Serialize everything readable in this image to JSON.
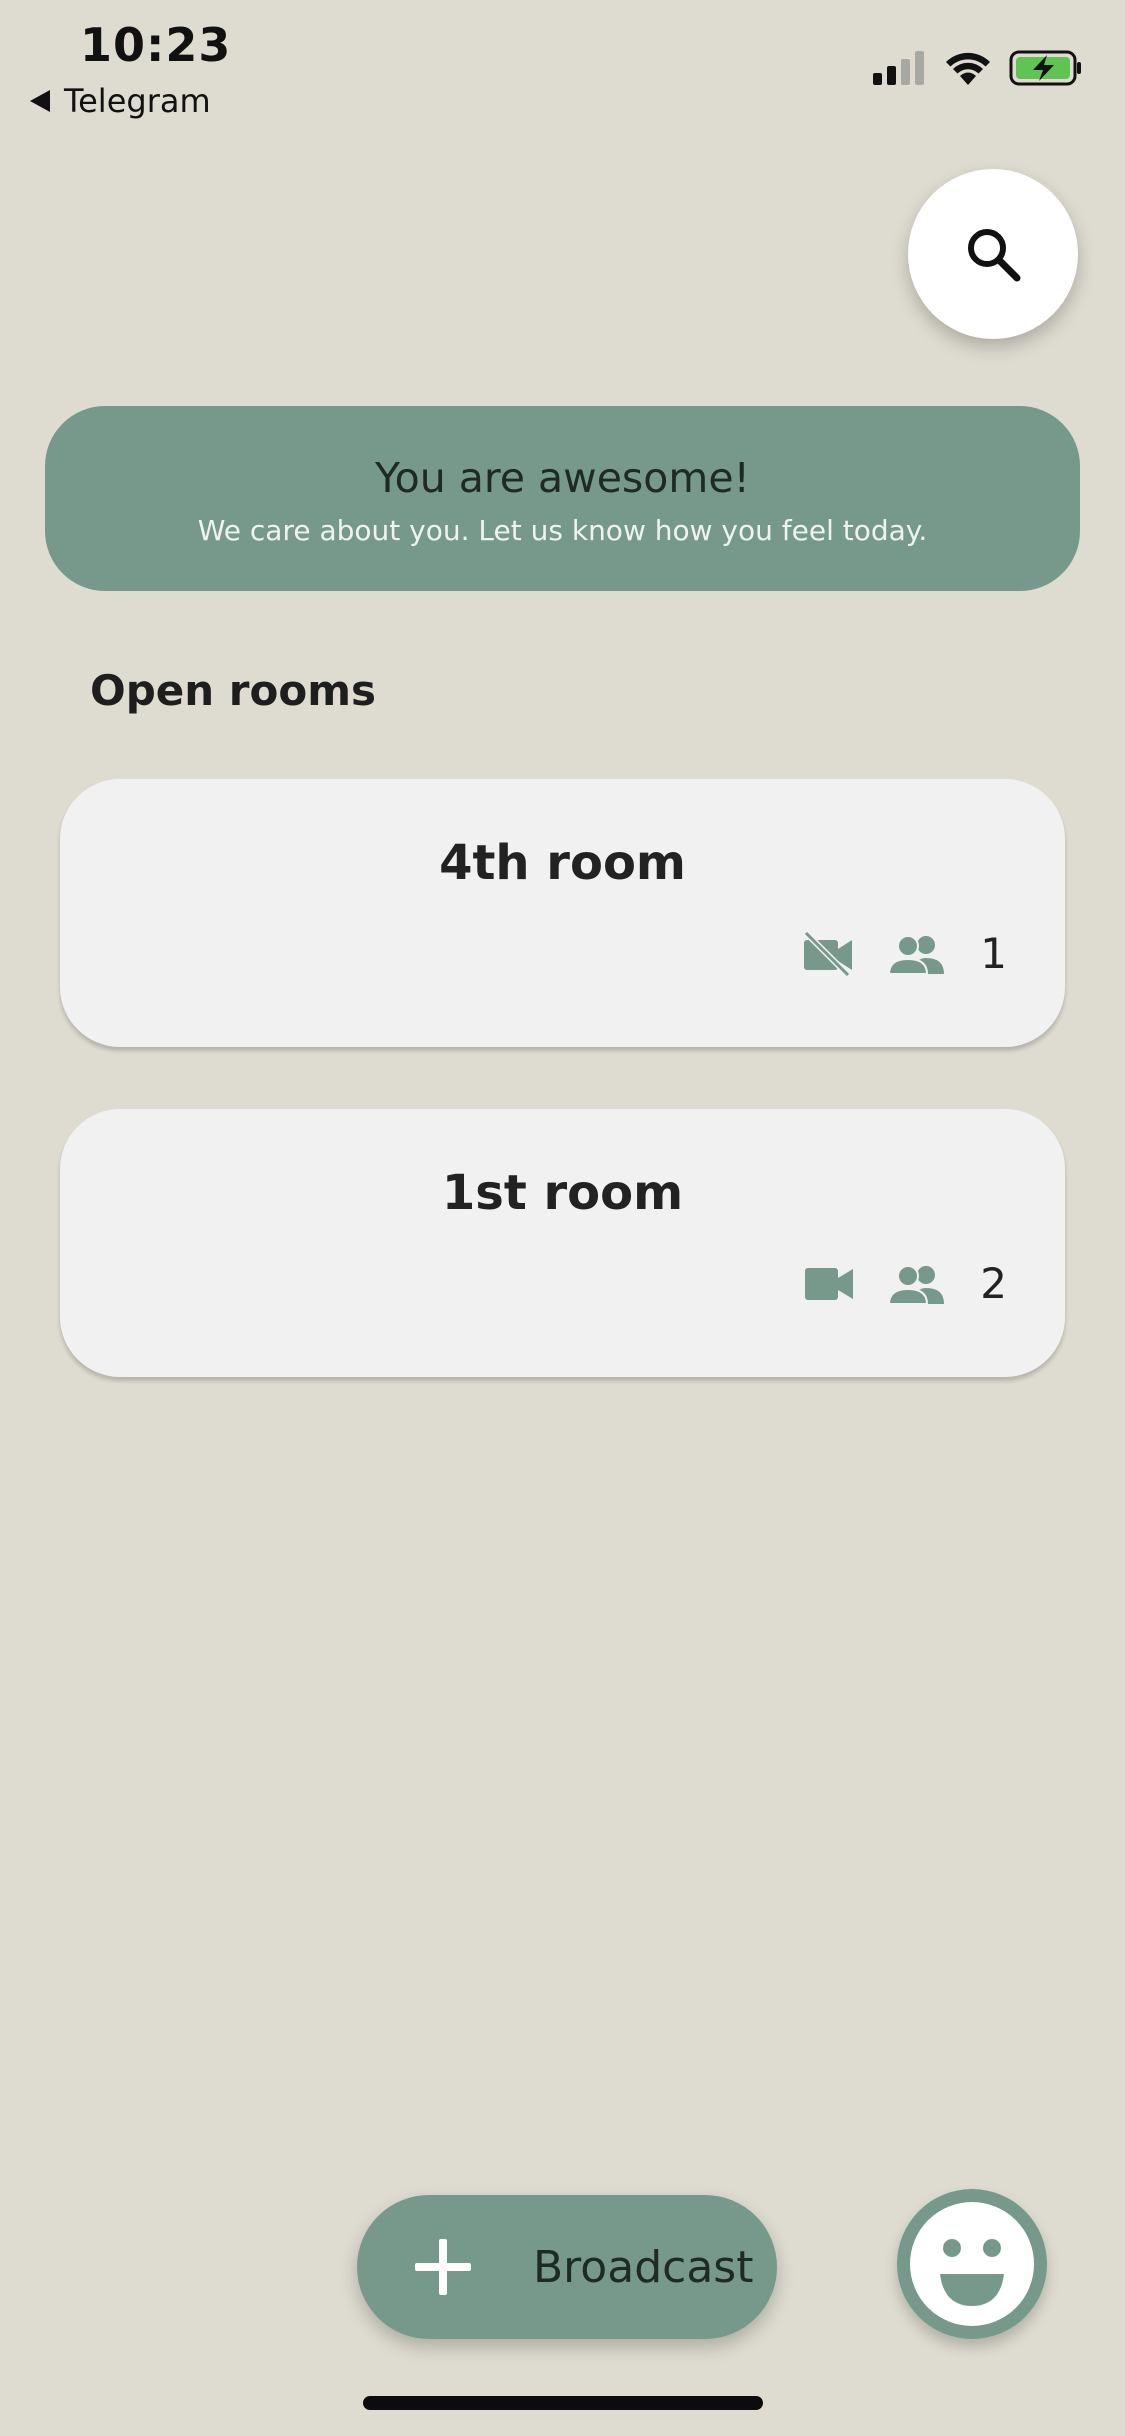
{
  "status_bar": {
    "time": "10:23",
    "back_app": "Telegram",
    "icons": [
      "signal-icon",
      "wifi-icon",
      "battery-charging-icon"
    ]
  },
  "search": {
    "icon": "search-icon"
  },
  "banner": {
    "title": "You are awesome!",
    "subtitle": "We care about you. Let us know how you feel today."
  },
  "section": {
    "title": "Open rooms"
  },
  "rooms": [
    {
      "name": "4th room",
      "video_icon": "video-off-icon",
      "people_icon": "people-icon",
      "count": "1"
    },
    {
      "name": "1st room",
      "video_icon": "video-icon",
      "people_icon": "people-icon",
      "count": "2"
    }
  ],
  "actions": {
    "broadcast_label": "Broadcast",
    "broadcast_icon": "plus-icon",
    "mood_icon": "smiley-icon"
  },
  "colors": {
    "background": "#dedcd0",
    "accent": "#76998b",
    "card": "#f1f1f1",
    "battery_fill": "#5fc454"
  }
}
